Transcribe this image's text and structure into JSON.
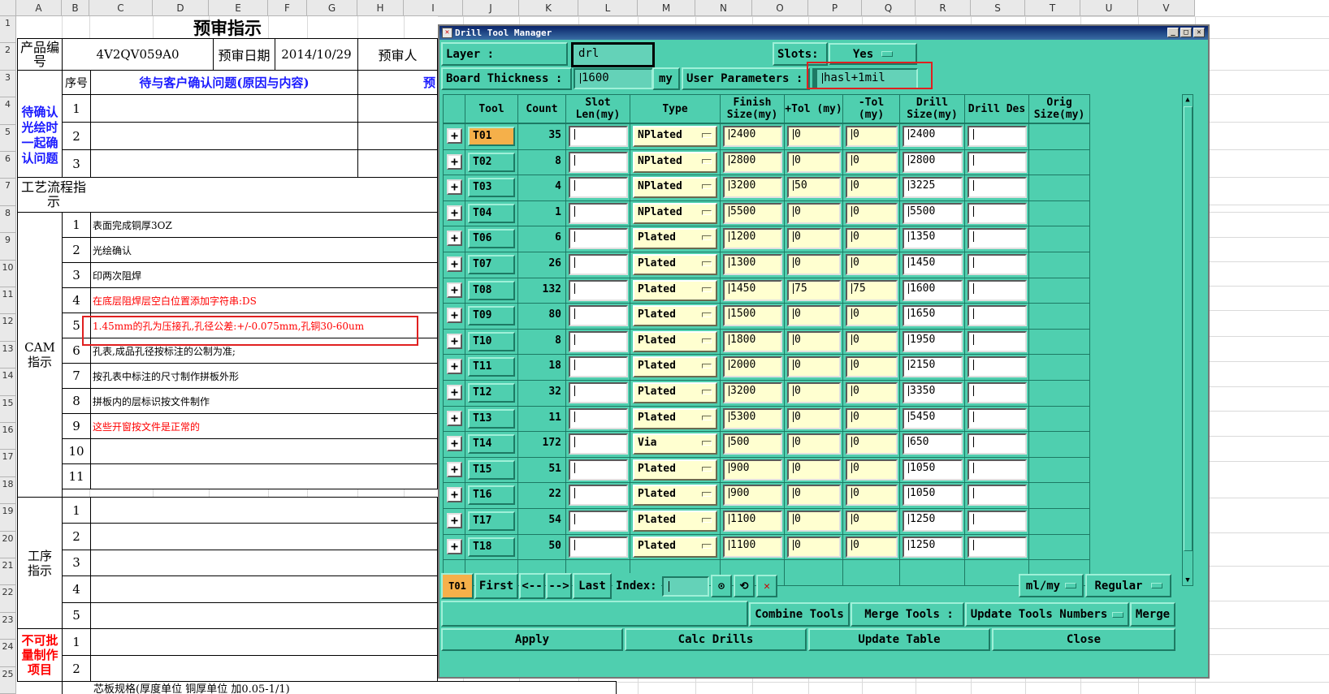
{
  "sheet": {
    "col_headers": [
      "A",
      "B",
      "C",
      "D",
      "E",
      "F",
      "G",
      "H",
      "I",
      "J",
      "K",
      "L",
      "M",
      "N",
      "O",
      "P",
      "Q",
      "R",
      "S",
      "T",
      "U",
      "V"
    ],
    "row_headers": [
      "1",
      "2",
      "3",
      "4",
      "5",
      "6",
      "7",
      "8",
      "9",
      "10",
      "11",
      "12",
      "13",
      "14",
      "15",
      "16",
      "17",
      "18",
      "19",
      "20",
      "21",
      "22",
      "23",
      "24",
      "25"
    ],
    "title": "预审指示",
    "product_label": "产品编号",
    "product_value": "4V2QV059A0",
    "date_label": "预审日期",
    "date_value": "2014/10/29",
    "reviewer_label": "预审人",
    "seq_label": "序号",
    "issue_header": "待与客户确认问题(原因与内容)",
    "partial_header": "预",
    "confirm_label": "待确认光绘时一起确认问题",
    "flow_label": "工艺流程指示",
    "cam_label": "CAM指示",
    "process_label": "工序指示",
    "nobatch_label": "不可批量制作项目",
    "confirm_rows": [
      "1",
      "2",
      "3"
    ],
    "cam_rows": [
      {
        "n": "1",
        "text": "表面完成铜厚3OZ",
        "red": false
      },
      {
        "n": "2",
        "text": "光绘确认",
        "red": false
      },
      {
        "n": "3",
        "text": "印两次阻焊",
        "red": false
      },
      {
        "n": "4",
        "text": "在底层阻焊层空白位置添加字符串:DS",
        "red": true
      },
      {
        "n": "5",
        "text": "1.45mm的孔为压接孔,孔径公差:+/-0.075mm,孔铜30-60um",
        "red": true
      },
      {
        "n": "6",
        "text": "孔表,成品孔径按标注的公制为准;",
        "red": false
      },
      {
        "n": "7",
        "text": "按孔表中标注的尺寸制作拼板外形",
        "red": false
      },
      {
        "n": "8",
        "text": "拼板内的层标识按文件制作",
        "red": false
      },
      {
        "n": "9",
        "text": "这些开窗按文件是正常的",
        "red": true
      },
      {
        "n": "10",
        "text": "",
        "red": false
      },
      {
        "n": "11",
        "text": "",
        "red": false
      }
    ],
    "process_rows": [
      "1",
      "2",
      "3",
      "4",
      "5"
    ],
    "nobatch_rows": [
      "1",
      "2"
    ],
    "bottom_text": "芯板规格(厚度单位     铜厚单位      加0.05-1/1)"
  },
  "dialog": {
    "title": "Drill Tool Manager",
    "layer_label": "Layer              :",
    "layer_value": "drl",
    "slots_label": "Slots:",
    "slots_value": "Yes",
    "thickness_label": "Board Thickness  :",
    "thickness_value": "1600",
    "thickness_unit": "my",
    "user_params_label": "User Parameters :",
    "user_params_value": "hasl+1mil",
    "headers": {
      "tool": "Tool",
      "count": "Count",
      "slot_len": "Slot Len(my)",
      "type": "Type",
      "finish_size": "Finish Size(my)",
      "plus_tol": "+Tol (my)",
      "minus_tol": "-Tol (my)",
      "drill_size": "Drill Size(my)",
      "drill_des": "Drill Des",
      "orig_size": "Orig Size(my)"
    },
    "rows": [
      {
        "tool": "T01",
        "count": "35",
        "type": "NPlated",
        "finish": "2400",
        "ptol": "0",
        "mtol": "0",
        "drill": "2400"
      },
      {
        "tool": "T02",
        "count": "8",
        "type": "NPlated",
        "finish": "2800",
        "ptol": "0",
        "mtol": "0",
        "drill": "2800"
      },
      {
        "tool": "T03",
        "count": "4",
        "type": "NPlated",
        "finish": "3200",
        "ptol": "50",
        "mtol": "0",
        "drill": "3225"
      },
      {
        "tool": "T04",
        "count": "1",
        "type": "NPlated",
        "finish": "5500",
        "ptol": "0",
        "mtol": "0",
        "drill": "5500"
      },
      {
        "tool": "T06",
        "count": "6",
        "type": "Plated",
        "finish": "1200",
        "ptol": "0",
        "mtol": "0",
        "drill": "1350"
      },
      {
        "tool": "T07",
        "count": "26",
        "type": "Plated",
        "finish": "1300",
        "ptol": "0",
        "mtol": "0",
        "drill": "1450"
      },
      {
        "tool": "T08",
        "count": "132",
        "type": "Plated",
        "finish": "1450",
        "ptol": "75",
        "mtol": "75",
        "drill": "1600"
      },
      {
        "tool": "T09",
        "count": "80",
        "type": "Plated",
        "finish": "1500",
        "ptol": "0",
        "mtol": "0",
        "drill": "1650"
      },
      {
        "tool": "T10",
        "count": "8",
        "type": "Plated",
        "finish": "1800",
        "ptol": "0",
        "mtol": "0",
        "drill": "1950"
      },
      {
        "tool": "T11",
        "count": "18",
        "type": "Plated",
        "finish": "2000",
        "ptol": "0",
        "mtol": "0",
        "drill": "2150"
      },
      {
        "tool": "T12",
        "count": "32",
        "type": "Plated",
        "finish": "3200",
        "ptol": "0",
        "mtol": "0",
        "drill": "3350"
      },
      {
        "tool": "T13",
        "count": "11",
        "type": "Plated",
        "finish": "5300",
        "ptol": "0",
        "mtol": "0",
        "drill": "5450"
      },
      {
        "tool": "T14",
        "count": "172",
        "type": "Via",
        "finish": "500",
        "ptol": "0",
        "mtol": "0",
        "drill": "650"
      },
      {
        "tool": "T15",
        "count": "51",
        "type": "Plated",
        "finish": "900",
        "ptol": "0",
        "mtol": "0",
        "drill": "1050"
      },
      {
        "tool": "T16",
        "count": "22",
        "type": "Plated",
        "finish": "900",
        "ptol": "0",
        "mtol": "0",
        "drill": "1050"
      },
      {
        "tool": "T17",
        "count": "54",
        "type": "Plated",
        "finish": "1100",
        "ptol": "0",
        "mtol": "0",
        "drill": "1250"
      },
      {
        "tool": "T18",
        "count": "50",
        "type": "Plated",
        "finish": "1100",
        "ptol": "0",
        "mtol": "0",
        "drill": "1250"
      }
    ],
    "current_tool": "T01",
    "first_label": "First",
    "prev_label": "<--",
    "next_label": "-->",
    "last_label": "Last",
    "index_label": "Index:",
    "units_value": "ml/my",
    "mode_value": "Regular",
    "combine_label": "Combine Tools",
    "merge_tools_label": "Merge Tools :",
    "update_numbers_label": "Update Tools Numbers",
    "merge_label": "Merge",
    "apply_label": "Apply",
    "calc_label": "Calc Drills",
    "update_table_label": "Update Table",
    "close_label": "Close",
    "colors": {
      "bg": "#4fcfaf",
      "selected": "#f5b04a",
      "highlight": "#ffffd0"
    }
  }
}
